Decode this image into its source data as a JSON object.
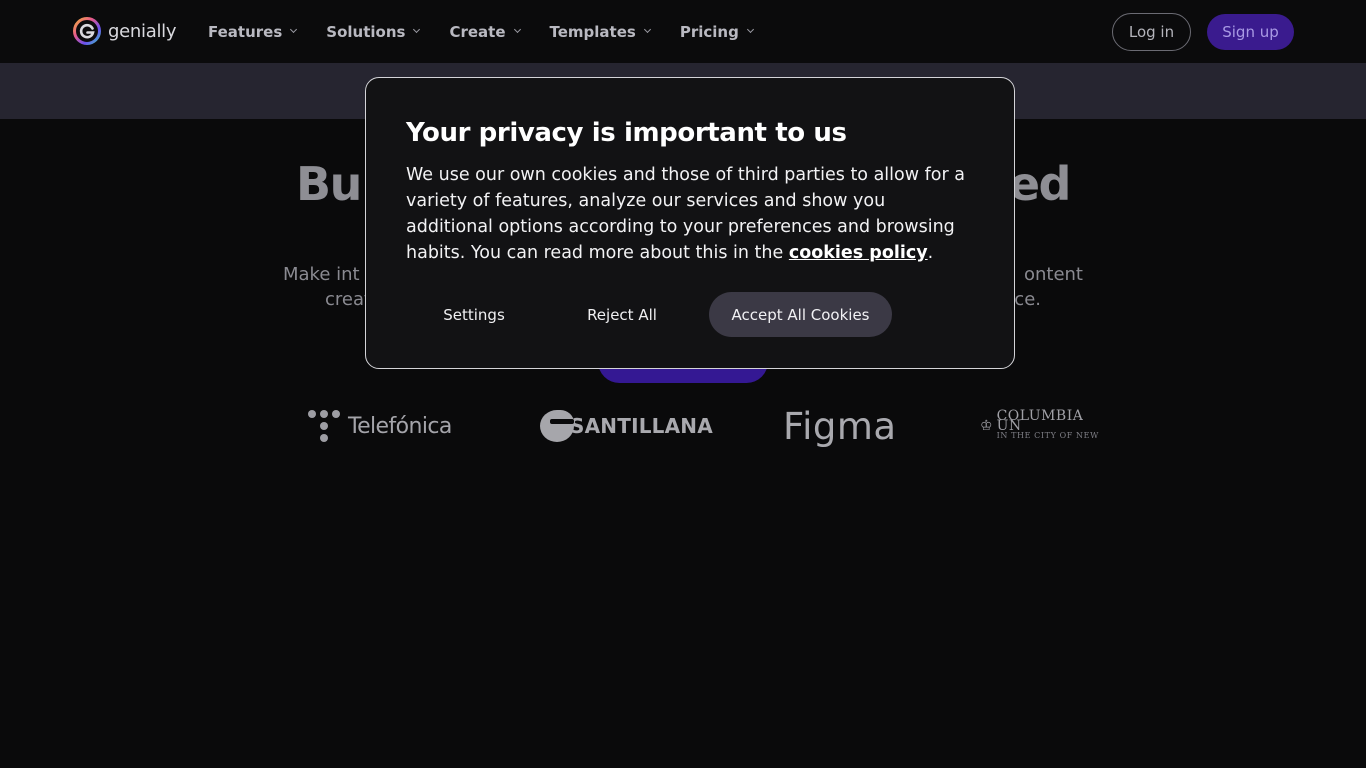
{
  "header": {
    "brand": "genially",
    "nav": [
      {
        "label": "Features"
      },
      {
        "label": "Solutions"
      },
      {
        "label": "Create"
      },
      {
        "label": "Templates"
      },
      {
        "label": "Pricing"
      }
    ],
    "login_label": "Log in",
    "signup_label": "Sign up"
  },
  "hero": {
    "title_left": "Bu",
    "title_right": "ed",
    "sub_line1_left": "Make int",
    "sub_line1_right": "ontent",
    "sub_line2_left": "creat",
    "sub_line2_right": "ce."
  },
  "logos": {
    "telefonica": "Telefónica",
    "santillana": "SANTILLANA",
    "figma": "Figma",
    "columbia_line1": "COLUMBIA UN",
    "columbia_line2": "IN THE CITY OF NEW"
  },
  "cookie_modal": {
    "title": "Your privacy is important to us",
    "body": "We use our own cookies and those of third parties to allow for a variety of features, analyze our services and show you additional options according to your preferences and browsing habits. You can read more about this in the",
    "link_label": "cookies policy",
    "body_end": ".",
    "settings_label": "Settings",
    "reject_label": "Reject All",
    "accept_label": "Accept All Cookies"
  },
  "colors": {
    "background": "#0a0a0b",
    "banner": "#262530",
    "signup_bg": "#3a1b8e",
    "accept_bg": "#3b3945",
    "modal_bg": "#121214"
  }
}
